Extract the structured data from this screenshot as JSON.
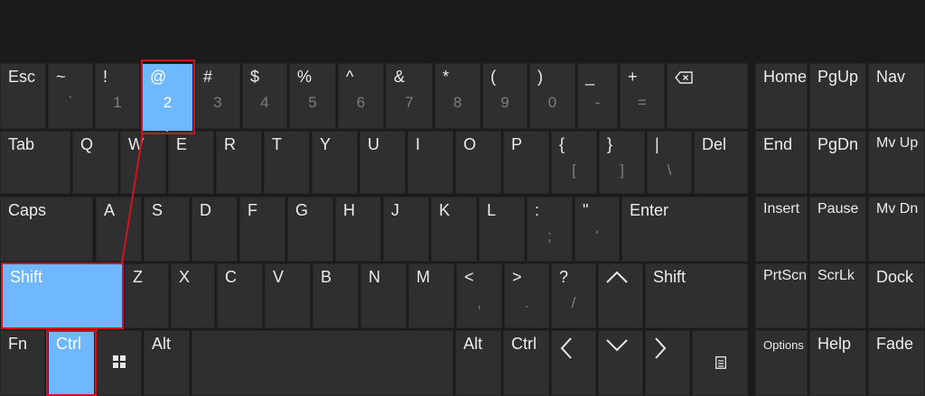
{
  "colors": {
    "background": "#1b1b1b",
    "key": "#2f2f2f",
    "key_highlight": "#6fb8ff",
    "annotation_red": "#d0141e",
    "secondary_label": "#7d7d7d"
  },
  "keyboard": {
    "row1": {
      "esc": "Esc",
      "tilde": {
        "top": "~",
        "bottom": "`"
      },
      "k1": {
        "top": "!",
        "bottom": "1"
      },
      "k2": {
        "top": "@",
        "bottom": "2"
      },
      "k3": {
        "top": "#",
        "bottom": "3"
      },
      "k4": {
        "top": "$",
        "bottom": "4"
      },
      "k5": {
        "top": "%",
        "bottom": "5"
      },
      "k6": {
        "top": "^",
        "bottom": "6"
      },
      "k7": {
        "top": "&",
        "bottom": "7"
      },
      "k8": {
        "top": "*",
        "bottom": "8"
      },
      "k9": {
        "top": "(",
        "bottom": "9"
      },
      "k0": {
        "top": ")",
        "bottom": "0"
      },
      "minus": {
        "top": "_",
        "bottom": "-"
      },
      "equals": {
        "top": "+",
        "bottom": "="
      },
      "backspace_icon": "backspace-icon"
    },
    "row2": {
      "tab": "Tab",
      "letters": [
        "Q",
        "W",
        "E",
        "R",
        "T",
        "Y",
        "U",
        "I",
        "O",
        "P"
      ],
      "lbracket": {
        "top": "{",
        "bottom": "["
      },
      "rbracket": {
        "top": "}",
        "bottom": "]"
      },
      "backslash": {
        "top": "|",
        "bottom": "\\"
      },
      "del": "Del"
    },
    "row3": {
      "caps": "Caps",
      "letters": [
        "A",
        "S",
        "D",
        "F",
        "G",
        "H",
        "J",
        "K",
        "L"
      ],
      "semicolon": {
        "top": ":",
        "bottom": ";"
      },
      "quote": {
        "top": "\"",
        "bottom": "'"
      },
      "enter": "Enter"
    },
    "row4": {
      "shift_left": "Shift",
      "letters": [
        "Z",
        "X",
        "C",
        "V",
        "B",
        "N",
        "M"
      ],
      "comma": {
        "top": "<",
        "bottom": ","
      },
      "period": {
        "top": ">",
        "bottom": "."
      },
      "slash": {
        "top": "?",
        "bottom": "/"
      },
      "shift_right": "Shift"
    },
    "row5": {
      "fn": "Fn",
      "ctrl_left": "Ctrl",
      "alt_left": "Alt",
      "alt_right": "Alt",
      "ctrl_right": "Ctrl"
    },
    "nav": {
      "home": "Home",
      "pgup": "PgUp",
      "nav": "Nav",
      "end": "End",
      "pgdn": "PgDn",
      "mvup": "Mv Up",
      "insert": "Insert",
      "pause": "Pause",
      "mvdn": "Mv Dn",
      "prtscn": "PrtScn",
      "scrlk": "ScrLk",
      "dock": "Dock",
      "options": "Options",
      "help": "Help",
      "fade": "Fade"
    },
    "highlighted_keys": [
      "@ 2",
      "Shift",
      "Ctrl"
    ]
  }
}
